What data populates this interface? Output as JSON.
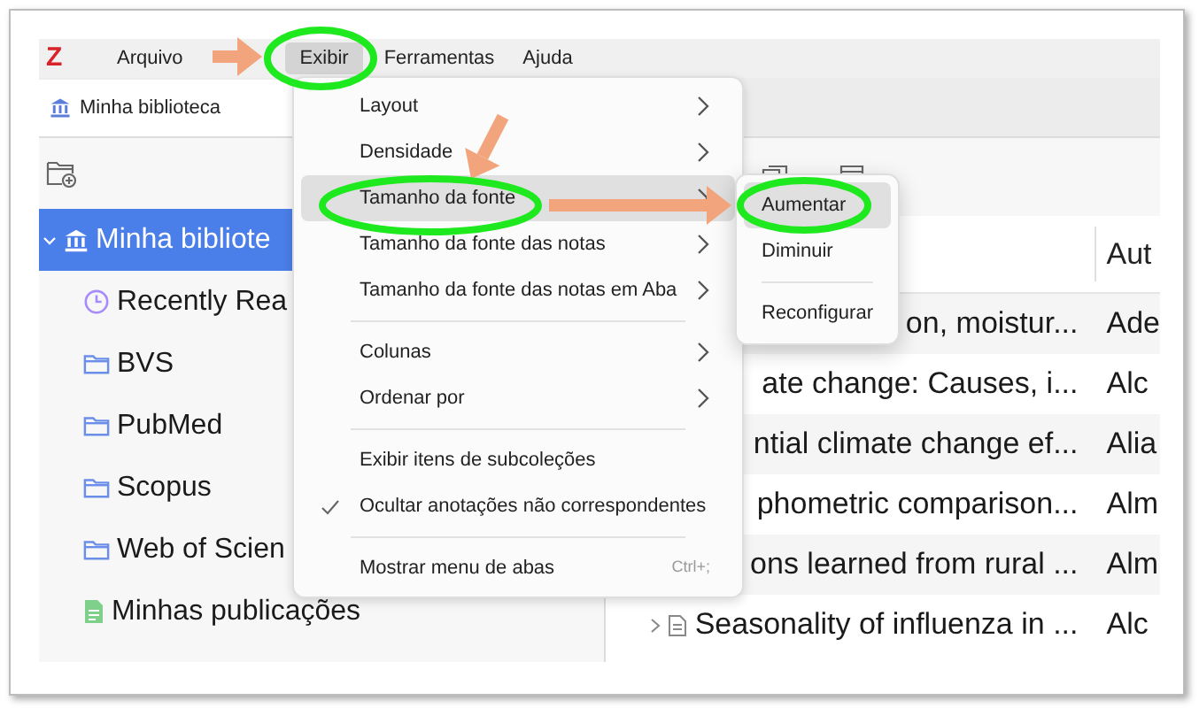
{
  "app": {
    "logo": "Z"
  },
  "menu_bar": [
    {
      "label": "Arquivo",
      "selected": false
    },
    {
      "label": "Exibir",
      "selected": true
    },
    {
      "label": "Ferramentas",
      "selected": false
    },
    {
      "label": "Ajuda",
      "selected": false
    }
  ],
  "tabs": [
    {
      "label": "Minha biblioteca",
      "selected": true
    }
  ],
  "collections": [
    {
      "label": "Minha bibliote",
      "kind": "library",
      "selected": true,
      "expanded": true
    },
    {
      "label": "Recently Rea",
      "kind": "recent",
      "selected": false
    },
    {
      "label": "BVS",
      "kind": "folder",
      "selected": false
    },
    {
      "label": "PubMed",
      "kind": "folder",
      "selected": false
    },
    {
      "label": "Scopus",
      "kind": "folder",
      "selected": false
    },
    {
      "label": "Web of Scien",
      "kind": "folder",
      "selected": false
    },
    {
      "label": "Minhas publicações",
      "kind": "publications",
      "selected": false
    }
  ],
  "items_table": {
    "columns": [
      {
        "label": "Aut"
      }
    ],
    "rows": [
      {
        "title": "on, moistur...",
        "author": "Ade",
        "kind": "plain"
      },
      {
        "title": "ate change: Causes, i...",
        "author": "Alc",
        "kind": "plain"
      },
      {
        "title": "ntial climate change ef...",
        "author": "Alia",
        "kind": "plain"
      },
      {
        "title": "phometric comparison...",
        "author": "Alm",
        "kind": "plain"
      },
      {
        "title": "ons learned from rural ...",
        "author": "Alm",
        "kind": "plain"
      },
      {
        "title": "Seasonality of influenza in ...",
        "author": "Alc",
        "kind": "parent"
      }
    ]
  },
  "view_menu": {
    "items": [
      {
        "kind": "submenu",
        "label": "Layout",
        "selected": false
      },
      {
        "kind": "submenu",
        "label": "Densidade",
        "selected": false
      },
      {
        "kind": "submenu",
        "label": "Tamanho da fonte",
        "selected": true
      },
      {
        "kind": "submenu",
        "label": "Tamanho da fonte das notas",
        "selected": false
      },
      {
        "kind": "submenu",
        "label": "Tamanho da fonte das notas em Aba",
        "selected": false
      },
      {
        "kind": "separator"
      },
      {
        "kind": "submenu",
        "label": "Colunas",
        "selected": false
      },
      {
        "kind": "submenu",
        "label": "Ordenar por",
        "selected": false
      },
      {
        "kind": "separator"
      },
      {
        "kind": "check",
        "label": "Exibir itens de subcoleções",
        "checked": false
      },
      {
        "kind": "check",
        "label": "Ocultar anotações não correspondentes",
        "checked": true
      },
      {
        "kind": "separator"
      },
      {
        "kind": "action",
        "label": "Mostrar menu de abas",
        "shortcut": "Ctrl+;"
      }
    ]
  },
  "font_size_submenu": {
    "items": [
      {
        "kind": "action",
        "label": "Aumentar",
        "selected": true
      },
      {
        "kind": "action",
        "label": "Diminuir",
        "selected": false
      },
      {
        "kind": "separator"
      },
      {
        "kind": "action",
        "label": "Reconfigurar",
        "selected": false
      }
    ]
  }
}
